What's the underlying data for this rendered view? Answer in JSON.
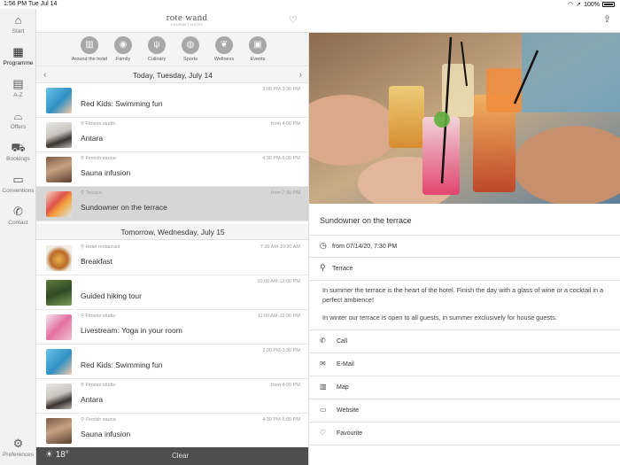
{
  "status": {
    "time": "1:56 PM",
    "date": "Tue Jul 14",
    "battery": "100%"
  },
  "rail": [
    {
      "label": "Start",
      "icon": "home-icon"
    },
    {
      "label": "Programme",
      "icon": "calendar-icon",
      "active": true
    },
    {
      "label": "A-Z",
      "icon": "book-icon"
    },
    {
      "label": "Offers",
      "icon": "cloche-icon"
    },
    {
      "label": "Bookings",
      "icon": "cart-icon"
    },
    {
      "label": "Conventions",
      "icon": "presentation-icon"
    },
    {
      "label": "Contact",
      "icon": "phone-icon"
    }
  ],
  "rail_bottom": {
    "label": "Preferences",
    "icon": "gear-icon"
  },
  "header": {
    "brand": "rote wand",
    "brand_sub": "GOURMET HOTEL"
  },
  "categories": [
    {
      "label": "Around the hotel",
      "icon": "map-icon"
    },
    {
      "label": "Family",
      "icon": "eye-icon"
    },
    {
      "label": "Culinary",
      "icon": "cutlery-icon"
    },
    {
      "label": "Sports",
      "icon": "ball-icon"
    },
    {
      "label": "Wellness",
      "icon": "lotus-icon"
    },
    {
      "label": "Events",
      "icon": "ticket-icon"
    }
  ],
  "day1": {
    "label": "Today, Tuesday, July 14",
    "items": [
      {
        "location": "",
        "time": "2:00 PM-3:30 PM",
        "title": "Red Kids: Swimming fun"
      },
      {
        "location": "Fitness studio",
        "time": "from 4:00 PM",
        "title": "Antara"
      },
      {
        "location": "Finnish sauna",
        "time": "4:30 PM-5:00 PM",
        "title": "Sauna infusion"
      },
      {
        "location": "Terrace",
        "time": "from 7:30 PM",
        "title": "Sundowner on the terrace",
        "selected": true
      }
    ]
  },
  "day2": {
    "label": "Tomorrow, Wednesday, July 15",
    "items": [
      {
        "location": "Hotel restaurant",
        "time": "7:30 AM-10:30 AM",
        "title": "Breakfast"
      },
      {
        "location": "",
        "time": "10:00 AM-12:00 PM",
        "title": "Guided hiking tour"
      },
      {
        "location": "Fitness studio",
        "time": "11:00 AM-12:00 PM",
        "title": "Livestream: Yoga in your room"
      },
      {
        "location": "",
        "time": "2:00 PM-3:30 PM",
        "title": "Red Kids: Swimming fun"
      },
      {
        "location": "Fitness studio",
        "time": "from 4:00 PM",
        "title": "Antara"
      },
      {
        "location": "Finnish sauna",
        "time": "4:30 PM-5:00 PM",
        "title": "Sauna infusion"
      }
    ]
  },
  "bottombar": {
    "temperature": "18°",
    "clear_label": "Clear"
  },
  "detail": {
    "title": "Sundowner on the terrace",
    "when": "from 07/14/20, 7:30 PM",
    "where": "Terrace",
    "paragraph1": "In summer the terrace is the heart of the hotel. Finish the day with a glass of wine or a cocktail in a perfect ambience!",
    "paragraph2": "In winter our terrace is open to all guests, in summer exclusively for house guests.",
    "actions": [
      {
        "label": "Call",
        "icon": "phone-icon"
      },
      {
        "label": "E-Mail",
        "icon": "mail-icon"
      },
      {
        "label": "Map",
        "icon": "map-icon"
      },
      {
        "label": "Website",
        "icon": "browser-icon"
      },
      {
        "label": "Favourite",
        "icon": "heart-icon"
      }
    ]
  },
  "colors": {
    "selected_row": "#d6d6d6",
    "rail_bg": "#f2f2f2",
    "bottombar": "#4e4e4e"
  }
}
